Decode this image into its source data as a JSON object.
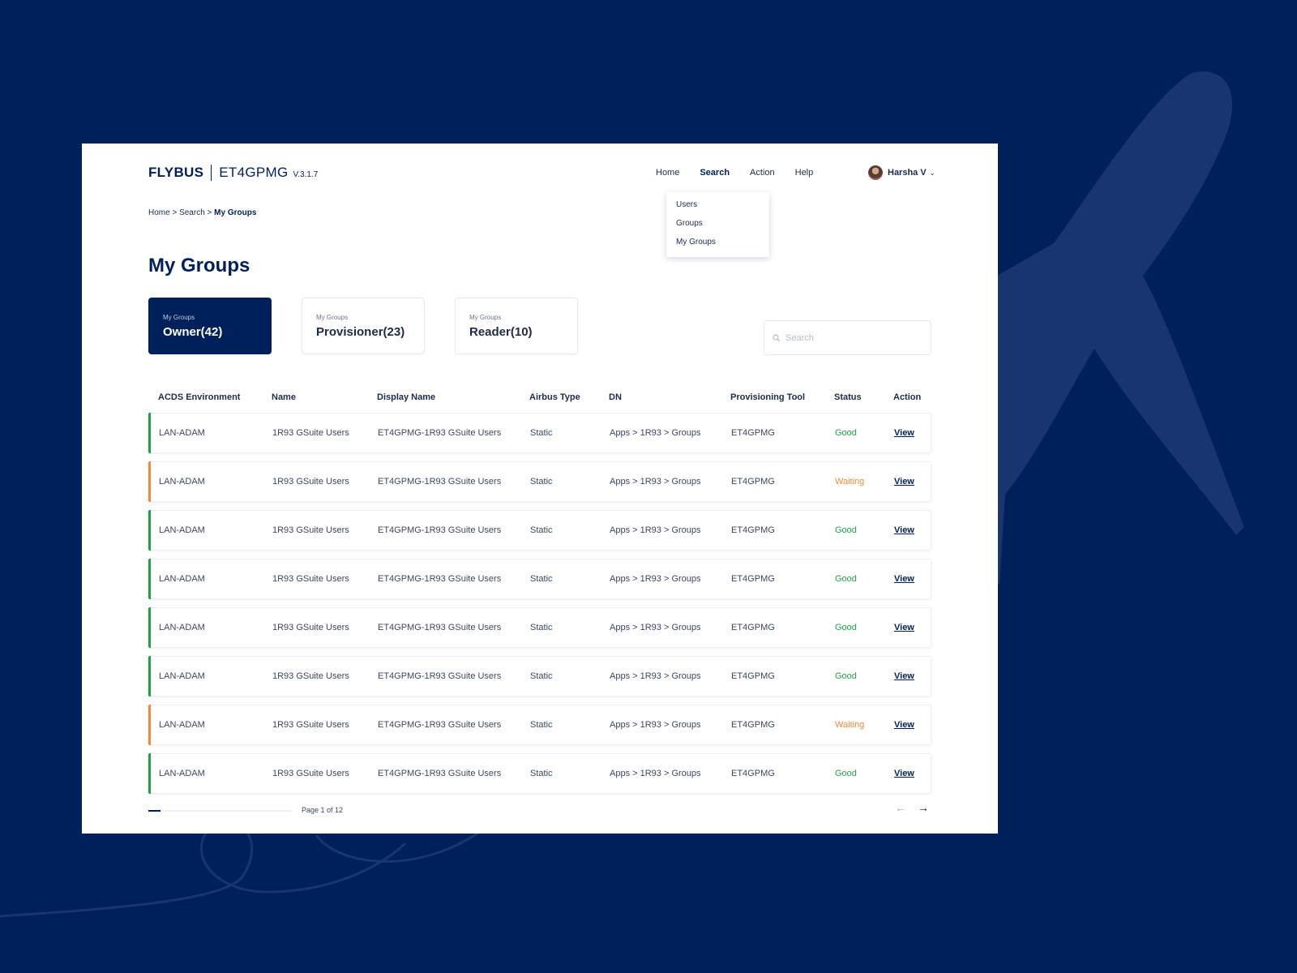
{
  "brand": {
    "name": "FLYBUS",
    "app": "ET4GPMG",
    "version": "V.3.1.7"
  },
  "nav": {
    "items": [
      {
        "label": "Home",
        "active": false
      },
      {
        "label": "Search",
        "active": true
      },
      {
        "label": "Action",
        "active": false
      },
      {
        "label": "Help",
        "active": false
      }
    ],
    "user": {
      "name": "Harsha V"
    },
    "dropdown": [
      "Users",
      "Groups",
      "My Groups"
    ]
  },
  "breadcrumb": {
    "prefix": "Home > Search > ",
    "current": "My Groups"
  },
  "page_title": "My Groups",
  "tabs": [
    {
      "small": "My Groups",
      "label": "Owner(42)",
      "active": true
    },
    {
      "small": "My Groups",
      "label": "Provisioner(23)",
      "active": false
    },
    {
      "small": "My Groups",
      "label": "Reader(10)",
      "active": false
    }
  ],
  "search": {
    "placeholder": "Search",
    "value": ""
  },
  "table": {
    "headers": [
      "ACDS Environment",
      "Name",
      "Display Name",
      "Airbus Type",
      "DN",
      "Provisioning Tool",
      "Status",
      "Action"
    ],
    "rows": [
      {
        "env": "LAN-ADAM",
        "name": "1R93 GSuite Users",
        "display_name": "ET4GPMG-1R93 GSuite Users",
        "type": "Static",
        "dn": "Apps > 1R93 > Groups",
        "tool": "ET4GPMG",
        "status": "Good",
        "action": "View"
      },
      {
        "env": "LAN-ADAM",
        "name": "1R93 GSuite Users",
        "display_name": "ET4GPMG-1R93 GSuite Users",
        "type": "Static",
        "dn": "Apps > 1R93 > Groups",
        "tool": "ET4GPMG",
        "status": "Waiting",
        "action": "View"
      },
      {
        "env": "LAN-ADAM",
        "name": "1R93 GSuite Users",
        "display_name": "ET4GPMG-1R93 GSuite Users",
        "type": "Static",
        "dn": "Apps > 1R93 > Groups",
        "tool": "ET4GPMG",
        "status": "Good",
        "action": "View"
      },
      {
        "env": "LAN-ADAM",
        "name": "1R93 GSuite Users",
        "display_name": "ET4GPMG-1R93 GSuite Users",
        "type": "Static",
        "dn": "Apps > 1R93 > Groups",
        "tool": "ET4GPMG",
        "status": "Good",
        "action": "View"
      },
      {
        "env": "LAN-ADAM",
        "name": "1R93 GSuite Users",
        "display_name": "ET4GPMG-1R93 GSuite Users",
        "type": "Static",
        "dn": "Apps > 1R93 > Groups",
        "tool": "ET4GPMG",
        "status": "Good",
        "action": "View"
      },
      {
        "env": "LAN-ADAM",
        "name": "1R93 GSuite Users",
        "display_name": "ET4GPMG-1R93 GSuite Users",
        "type": "Static",
        "dn": "Apps > 1R93 > Groups",
        "tool": "ET4GPMG",
        "status": "Good",
        "action": "View"
      },
      {
        "env": "LAN-ADAM",
        "name": "1R93 GSuite Users",
        "display_name": "ET4GPMG-1R93 GSuite Users",
        "type": "Static",
        "dn": "Apps > 1R93 > Groups",
        "tool": "ET4GPMG",
        "status": "Waiting",
        "action": "View"
      },
      {
        "env": "LAN-ADAM",
        "name": "1R93 GSuite Users",
        "display_name": "ET4GPMG-1R93 GSuite Users",
        "type": "Static",
        "dn": "Apps > 1R93 > Groups",
        "tool": "ET4GPMG",
        "status": "Good",
        "action": "View"
      }
    ]
  },
  "pagination": {
    "label": "Page 1 of 12",
    "current": 1,
    "total": 12,
    "prev_icon": "arrow-left-icon",
    "next_icon": "arrow-right-icon"
  },
  "colors": {
    "brand": "#00205b",
    "good": "#1ea14b",
    "waiting": "#f2893a",
    "background": "#00205b"
  },
  "icons": {
    "search": "search-icon",
    "user_menu": "chevron-down-icon",
    "avatar": "avatar"
  }
}
